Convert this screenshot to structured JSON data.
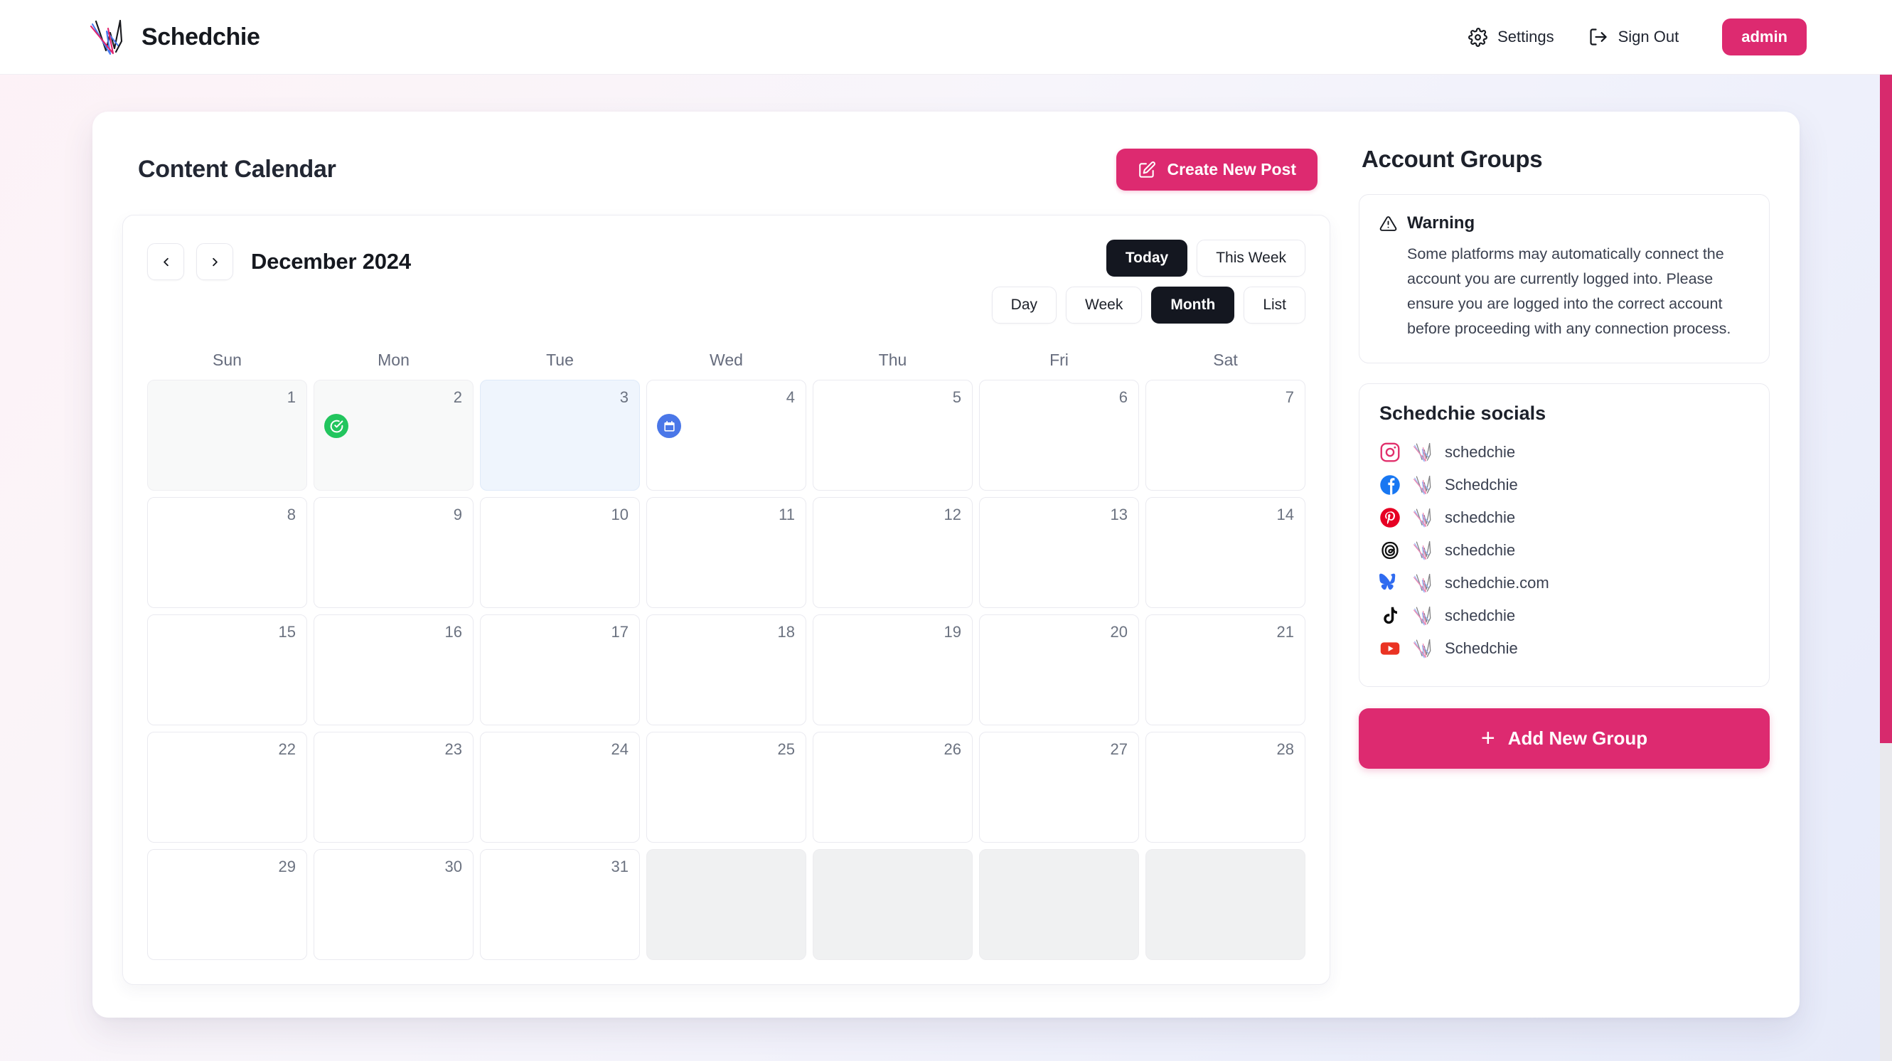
{
  "header": {
    "brand_name": "Schedchie",
    "logo_icon": "schedchie-logo",
    "nav": [
      {
        "label": "Settings",
        "icon": "gear-icon"
      },
      {
        "label": "Sign Out",
        "icon": "sign-out-icon"
      }
    ],
    "admin_label": "admin"
  },
  "main": {
    "page_title": "Content Calendar",
    "create_post_label": "Create New Post",
    "create_post_icon": "edit-square-icon",
    "calendar": {
      "prev_icon": "chevron-left-icon",
      "next_icon": "chevron-right-icon",
      "month_label": "December 2024",
      "range_buttons": [
        {
          "label": "Today",
          "active": true
        },
        {
          "label": "This Week",
          "active": false
        }
      ],
      "view_buttons": [
        {
          "label": "Day",
          "active": false
        },
        {
          "label": "Week",
          "active": false
        },
        {
          "label": "Month",
          "active": true
        },
        {
          "label": "List",
          "active": false
        }
      ],
      "weekdays": [
        "Sun",
        "Mon",
        "Tue",
        "Wed",
        "Thu",
        "Fri",
        "Sat"
      ],
      "cells": [
        {
          "day": "1",
          "state": "prev-month"
        },
        {
          "day": "2",
          "state": "prev-month",
          "badge": "green",
          "badge_icon": "check-circle-icon"
        },
        {
          "day": "3",
          "state": "today"
        },
        {
          "day": "4",
          "state": "normal",
          "badge": "blue",
          "badge_icon": "calendar-icon"
        },
        {
          "day": "5",
          "state": "normal"
        },
        {
          "day": "6",
          "state": "normal"
        },
        {
          "day": "7",
          "state": "normal"
        },
        {
          "day": "8",
          "state": "normal"
        },
        {
          "day": "9",
          "state": "normal"
        },
        {
          "day": "10",
          "state": "normal"
        },
        {
          "day": "11",
          "state": "normal"
        },
        {
          "day": "12",
          "state": "normal"
        },
        {
          "day": "13",
          "state": "normal"
        },
        {
          "day": "14",
          "state": "normal"
        },
        {
          "day": "15",
          "state": "normal"
        },
        {
          "day": "16",
          "state": "normal"
        },
        {
          "day": "17",
          "state": "normal"
        },
        {
          "day": "18",
          "state": "normal"
        },
        {
          "day": "19",
          "state": "normal"
        },
        {
          "day": "20",
          "state": "normal"
        },
        {
          "day": "21",
          "state": "normal"
        },
        {
          "day": "22",
          "state": "normal"
        },
        {
          "day": "23",
          "state": "normal"
        },
        {
          "day": "24",
          "state": "normal"
        },
        {
          "day": "25",
          "state": "normal"
        },
        {
          "day": "26",
          "state": "normal"
        },
        {
          "day": "27",
          "state": "normal"
        },
        {
          "day": "28",
          "state": "normal"
        },
        {
          "day": "29",
          "state": "normal"
        },
        {
          "day": "30",
          "state": "normal"
        },
        {
          "day": "31",
          "state": "normal"
        },
        {
          "day": "",
          "state": "muted"
        },
        {
          "day": "",
          "state": "muted"
        },
        {
          "day": "",
          "state": "muted"
        },
        {
          "day": "",
          "state": "muted"
        }
      ]
    }
  },
  "sidebar": {
    "title": "Account Groups",
    "warning": {
      "icon": "warning-triangle-icon",
      "title": "Warning",
      "body": "Some platforms may automatically connect the account you are currently logged into. Please ensure you are logged into the correct account before proceeding with any connection process."
    },
    "group": {
      "title": "Schedchie socials",
      "accounts": [
        {
          "platform": "instagram-icon",
          "avatar": "schedchie-avatar",
          "name": "schedchie"
        },
        {
          "platform": "facebook-icon",
          "avatar": "schedchie-avatar",
          "name": "Schedchie"
        },
        {
          "platform": "pinterest-icon",
          "avatar": "schedchie-avatar",
          "name": "schedchie"
        },
        {
          "platform": "threads-icon",
          "avatar": "schedchie-avatar",
          "name": "schedchie"
        },
        {
          "platform": "bluesky-icon",
          "avatar": "schedchie-avatar",
          "name": "schedchie.com"
        },
        {
          "platform": "tiktok-icon",
          "avatar": "schedchie-avatar",
          "name": "schedchie"
        },
        {
          "platform": "youtube-icon",
          "avatar": "schedchie-avatar",
          "name": "Schedchie"
        }
      ]
    },
    "add_group_label": "Add New Group",
    "add_group_icon": "plus-icon"
  },
  "colors": {
    "accent": "#dd2a70",
    "active_dark": "#141720",
    "today_cell": "#eff5fd",
    "badge_green": "#22c55e",
    "badge_blue": "#4a77e8",
    "scrollbar": "#d72a6d"
  }
}
